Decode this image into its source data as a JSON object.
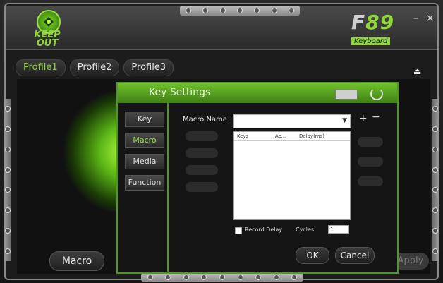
{
  "window": {
    "minimize_label": "–",
    "close_label": "×"
  },
  "brand": {
    "logo_text": "KEEP OUT",
    "product_name_prefix": "F",
    "product_name_number": "89",
    "product_sub": "Keyboard"
  },
  "profiles": {
    "tabs": [
      {
        "label": "Profile1",
        "active": true
      },
      {
        "label": "Profile2",
        "active": false
      },
      {
        "label": "Profile3",
        "active": false
      }
    ],
    "eject_icon": "⏏"
  },
  "main": {
    "macro_button": "Macro",
    "apply_button": "Apply",
    "glow_color": "#8fd63a"
  },
  "dialog": {
    "title": "Key Settings",
    "side_menu": [
      {
        "label": "Key",
        "active": false
      },
      {
        "label": "Macro",
        "active": true
      },
      {
        "label": "Media",
        "active": false
      },
      {
        "label": "Function",
        "active": false
      }
    ],
    "macro_name_label": "Macro Name",
    "macro_name_value": "",
    "add_label": "+",
    "remove_label": "−",
    "table_headers": [
      "Keys",
      "Ac...",
      "Delay(ms)"
    ],
    "table_rows": [],
    "record_delay_label": "Record Delay",
    "record_delay_checked": false,
    "cycles_label": "Cycles",
    "cycles_value": "1",
    "ok_label": "OK",
    "cancel_label": "Cancel"
  },
  "colors": {
    "accent": "#8fd63a",
    "dialog_border": "#4f9a1e"
  }
}
